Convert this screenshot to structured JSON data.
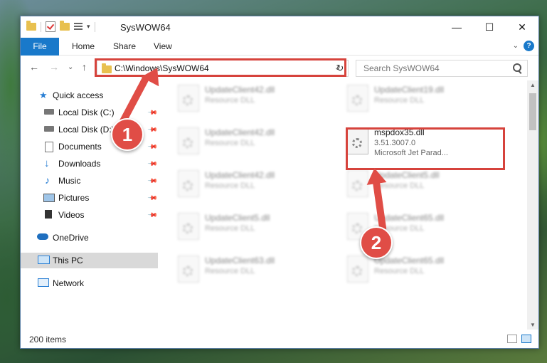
{
  "window": {
    "title": "SysWOW64",
    "controls": {
      "minimize": "—",
      "maximize": "☐",
      "close": "✕"
    }
  },
  "ribbon": {
    "tabs": [
      "File",
      "Home",
      "Share",
      "View"
    ],
    "help_label": "?"
  },
  "address_bar": {
    "path": "C:\\Windows\\SysWOW64",
    "search_placeholder": "Search SysWOW64"
  },
  "sidebar": {
    "items": [
      {
        "label": "Quick access",
        "icon": "star-icon"
      },
      {
        "label": "Local Disk (C:)",
        "icon": "drive-icon",
        "pinned": true
      },
      {
        "label": "Local Disk (D:)",
        "icon": "drive-icon",
        "pinned": true
      },
      {
        "label": "Documents",
        "icon": "document-icon",
        "pinned": true
      },
      {
        "label": "Downloads",
        "icon": "download-icon",
        "pinned": true
      },
      {
        "label": "Music",
        "icon": "music-icon",
        "pinned": true
      },
      {
        "label": "Pictures",
        "icon": "pictures-icon",
        "pinned": true
      },
      {
        "label": "Videos",
        "icon": "videos-icon",
        "pinned": true
      },
      {
        "label": "OneDrive",
        "icon": "cloud-icon"
      },
      {
        "label": "This PC",
        "icon": "computer-icon",
        "selected": true
      },
      {
        "label": "Network",
        "icon": "network-icon"
      }
    ]
  },
  "files": {
    "left": [
      {
        "name": "UpdateClient42.dll",
        "desc": "Resource DLL"
      },
      {
        "name": "UpdateClient42.dll",
        "desc": "Resource DLL"
      },
      {
        "name": "UpdateClient42.dll",
        "desc": "Resource DLL"
      },
      {
        "name": "UpdateClient5.dll",
        "desc": "Resource DLL"
      },
      {
        "name": "UpdateClient63.dll",
        "desc": "Resource DLL"
      }
    ],
    "right": [
      {
        "name": "UpdateClient19.dll",
        "desc": "Resource DLL"
      },
      {
        "name": "UpdateClient5.dll",
        "desc": "Resource DLL"
      },
      {
        "name": "UpdateClient65.dll",
        "desc": "Resource DLL"
      },
      {
        "name": "UpdateClient65.dll",
        "desc": "Resource DLL"
      }
    ],
    "target": {
      "name": "mspdox35.dll",
      "version": "3.51.3007.0",
      "company": "Microsoft Jet Parad..."
    }
  },
  "status": {
    "item_count": "200 items"
  },
  "annotations": {
    "step1": "1",
    "step2": "2",
    "color": "#e04d46"
  }
}
